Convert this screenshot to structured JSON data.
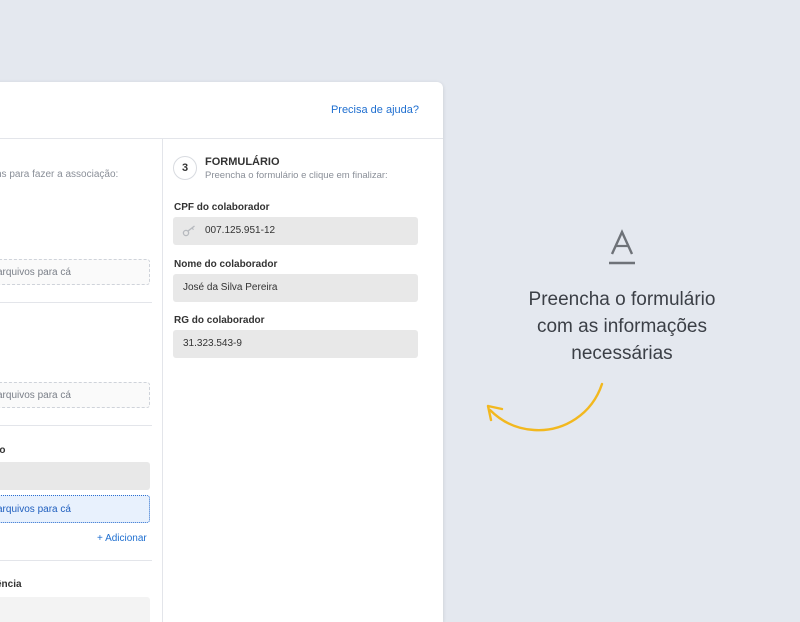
{
  "header": {
    "help_link": "Precisa de ajuda?"
  },
  "left": {
    "association_hint": "ns para fazer a associação:",
    "dropzone_1": "arquivos para cá",
    "dropzone_2": "arquivos para cá",
    "section_label_1": "to",
    "dropzone_3": "arquivos para cá",
    "add_link": "+ Adicionar",
    "section_label_2": "ência"
  },
  "step": {
    "number": "3",
    "title": "FORMULÁRIO",
    "subtitle": "Preencha o formulário e clique em finalizar:"
  },
  "form": {
    "cpf_label": "CPF do colaborador",
    "cpf_value": "007.125.951-12",
    "nome_label": "Nome do colaborador",
    "nome_value": "José da Silva Pereira",
    "rg_label": "RG do colaborador",
    "rg_value": "31.323.543-9"
  },
  "side": {
    "line1": "Preencha o formulário",
    "line2": "com as informações",
    "line3": "necessárias",
    "icon": "font-underline-icon",
    "arrow_color": "#f2b81f"
  },
  "colors": {
    "link": "#1f6fd0",
    "background": "#e4e8ef",
    "field": "#e8e8e8"
  }
}
